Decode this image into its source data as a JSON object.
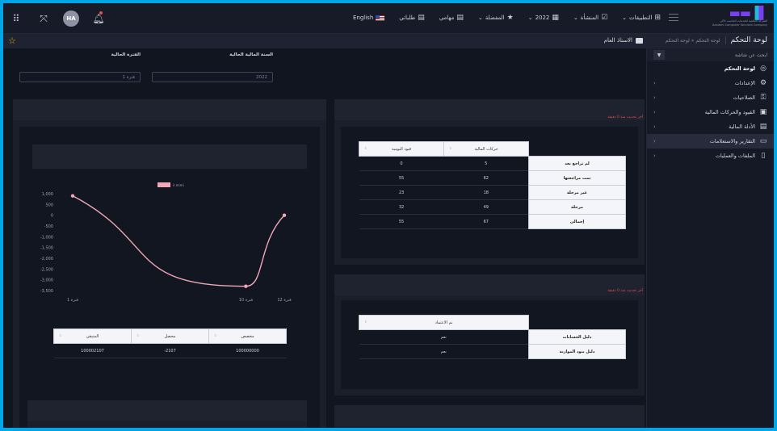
{
  "topbar": {
    "avatar_initials": "HA",
    "menu": [
      {
        "label": "التطبيقات",
        "glyph": "⊞",
        "chevron": "⌄"
      },
      {
        "label": "المنشأة",
        "glyph": "☑",
        "chevron": "⌄"
      },
      {
        "label": "2022",
        "glyph": "▦",
        "chevron": "⌄"
      },
      {
        "label": "المفضلة",
        "glyph": "★",
        "chevron": "⌄"
      },
      {
        "label": "مهامي",
        "glyph": "▤",
        "chevron": ""
      },
      {
        "label": "طلباتي",
        "glyph": "▤",
        "chevron": ""
      },
      {
        "label": "English",
        "glyph": "",
        "chevron": ""
      }
    ],
    "logo_sub1": "الشركة العالمية للخدمات الحاسب الآلي",
    "logo_sub2": "Aaalami Computer Services Company"
  },
  "subbar": {
    "title": "لوحة التحكم",
    "breadcrumb": "لوحة التحكم  «  لوحة التحكم",
    "account": "الاستاذ العام"
  },
  "sidebar": {
    "search_placeholder": "ابحث عن شاشة",
    "filter_icon": "▼",
    "items": [
      {
        "label": "لوحة التحكم",
        "icon": "◎",
        "chevron": ""
      },
      {
        "label": "الإعدادات",
        "icon": "⚙",
        "chevron": "‹"
      },
      {
        "label": "الصلاحيات",
        "icon": "⚿",
        "chevron": "‹"
      },
      {
        "label": "القيود والحركات المالية",
        "icon": "▣",
        "chevron": "‹"
      },
      {
        "label": "الأدلة المالية",
        "icon": "▤",
        "chevron": "‹"
      },
      {
        "label": "التقارير والاستعلامات",
        "icon": "▭",
        "chevron": "‹"
      },
      {
        "label": "الملفات والعمليات",
        "icon": "▯",
        "chevron": "‹"
      }
    ]
  },
  "filters": {
    "year_label": "السنة المالية الحالية",
    "year_value": "2022",
    "period_label": "الفترة الحالية",
    "period_value": "فترة 1"
  },
  "panel1": {
    "update_note": "آخر تحديث منذ 0 دقيقة",
    "columns": [
      "حركات المالية",
      "قيود اليومية"
    ],
    "rows": [
      {
        "label": "لم تراجع بعد",
        "values": [
          "5",
          "0"
        ]
      },
      {
        "label": "تمت مراجعتها",
        "values": [
          "62",
          "55"
        ]
      },
      {
        "label": "غير مرحلة",
        "values": [
          "18",
          "23"
        ]
      },
      {
        "label": "مرحلة",
        "values": [
          "49",
          "32"
        ]
      },
      {
        "label": "إجمالي",
        "values": [
          "67",
          "55"
        ]
      }
    ]
  },
  "panel2": {
    "update_note": "آخر تحديث منذ 0 دقيقة",
    "columns": [
      "تم الاعتماد"
    ],
    "rows": [
      {
        "label": "دليل الحسابات",
        "values": [
          "نعم"
        ]
      },
      {
        "label": "دليل بنود الموازنة",
        "values": [
          "نعم"
        ]
      }
    ]
  },
  "budget_table": {
    "columns": [
      "مخصص",
      "محصل",
      "المتبقي"
    ],
    "values": [
      "100000000",
      "2107-",
      "100002107"
    ]
  },
  "chart_data": {
    "type": "line",
    "title": "",
    "legend": "ir.mimi",
    "x": [
      "فترة 1",
      "فترة 10",
      "فترة 12"
    ],
    "x_positions": [
      1,
      10,
      12
    ],
    "values": [
      900,
      -3300,
      0
    ],
    "yticks": [
      "1,000",
      "500",
      "0",
      "-500",
      "-1,000",
      "-1,500",
      "-2,000",
      "-2,500",
      "-3,000",
      "-3,500"
    ],
    "ylim": [
      -3500,
      1000
    ],
    "color": "#f2a7b8"
  }
}
